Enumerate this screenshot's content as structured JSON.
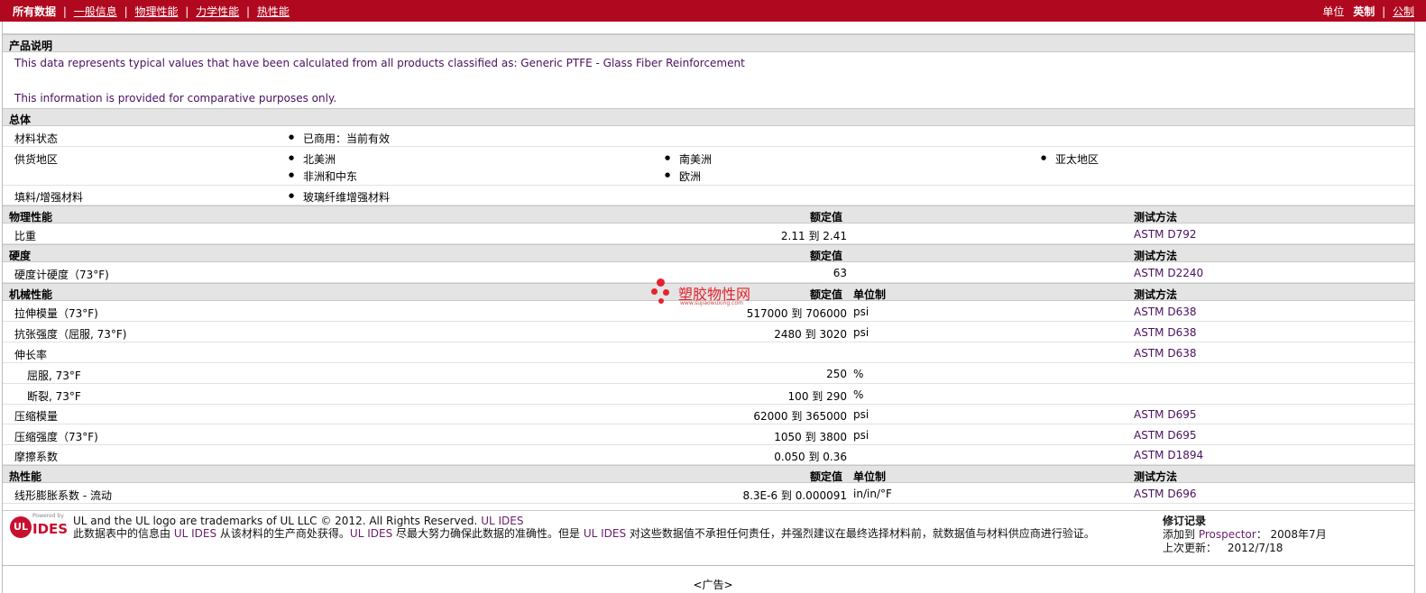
{
  "topbar": {
    "all_data": "所有数据",
    "links": [
      "一般信息",
      "物理性能",
      "力学性能",
      "热性能"
    ],
    "units_label": "单位",
    "unit_english": "英制",
    "unit_metric": "公制",
    "sep": "|"
  },
  "description": {
    "title": "产品说明",
    "line1": "This data represents typical values that have been calculated from all products classified as: Generic PTFE - Glass Fiber Reinforcement",
    "line2": "This information is provided for comparative purposes only."
  },
  "general": {
    "title": "总体",
    "material_status_label": "材料状态",
    "material_status": "已商用：当前有效",
    "supply_label": "供货地区",
    "regions": [
      "北美洲",
      "南美洲",
      "亚太地区",
      "非洲和中东",
      "欧洲"
    ],
    "filler_label": "填料/增强材料",
    "filler": "玻璃纤维增强材料"
  },
  "headers": {
    "nominal": "额定值",
    "unit": "单位制",
    "method": "测试方法"
  },
  "physical": {
    "title": "物理性能",
    "rows": [
      {
        "label": "比重",
        "value": "2.11 到  2.41",
        "unit": "",
        "method": "ASTM D792"
      }
    ]
  },
  "hardness": {
    "title": "硬度",
    "rows": [
      {
        "label": "硬度计硬度（73°F)",
        "value": "63",
        "unit": "",
        "method": "ASTM D2240"
      }
    ]
  },
  "mechanical": {
    "title": "机械性能",
    "rows": [
      {
        "label": "拉伸模量（73°F)",
        "value": "517000 到  706000",
        "unit": "psi",
        "method": "ASTM D638"
      },
      {
        "label": "抗张强度（屈服, 73°F)",
        "value": "2480 到  3020",
        "unit": "psi",
        "method": "ASTM D638"
      },
      {
        "label": "伸长率",
        "value": "",
        "unit": "",
        "method": "ASTM D638"
      },
      {
        "label": "屈服, 73°F",
        "value": "250",
        "unit": "%",
        "method": ""
      },
      {
        "label": "断裂, 73°F",
        "value": "100 到  290",
        "unit": "%",
        "method": ""
      },
      {
        "label": "压缩模量",
        "value": "62000 到  365000",
        "unit": "psi",
        "method": "ASTM D695"
      },
      {
        "label": "压缩强度（73°F)",
        "value": "1050 到  3800",
        "unit": "psi",
        "method": "ASTM D695"
      },
      {
        "label": "摩擦系数",
        "value": "0.050 到  0.36",
        "unit": "",
        "method": "ASTM D1894"
      }
    ]
  },
  "thermal": {
    "title": "热性能",
    "rows": [
      {
        "label": "线形膨胀系数  - 流动",
        "value": "8.3E-6 到  0.000091",
        "unit": "in/in/°F",
        "method": "ASTM D696"
      }
    ]
  },
  "watermark": {
    "main": "塑胶物性网",
    "sub": "www.sujiaowuxing.com"
  },
  "footer": {
    "logo_letters": "UL",
    "logo_powered": "Powered by",
    "logo_ides": "IDES",
    "trademark": "UL and the UL logo are trademarks of UL LLC © 2012. All Rights Reserved.",
    "ul_ides": "UL IDES",
    "dis_a": "此数据表中的信息由 ",
    "dis_b": " 从该材料的生产商处获得。",
    "dis_c": " 尽最大努力确保此数据的准确性。但是 ",
    "dis_d": " 对这些数据值不承担任何责任，并强烈建议在最终选择材料前，就数据值与材料供应商进行验证。",
    "rev_title": "修订记录",
    "added_label": "添加到 ",
    "prospector": "Prospector",
    "added_date": "：  2008年7月",
    "updated_label": "上次更新：",
    "updated_date": "2012/7/18"
  },
  "ad": "<广告>"
}
